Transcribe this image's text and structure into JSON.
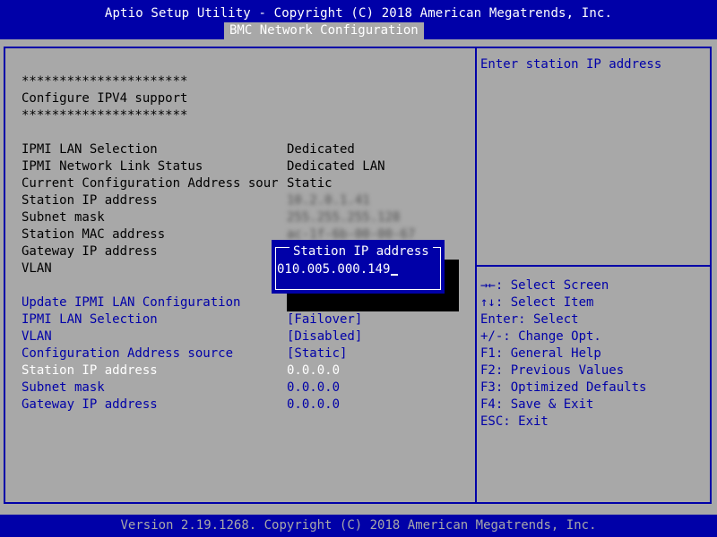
{
  "header": {
    "title": "Aptio Setup Utility - Copyright (C) 2018 American Megatrends, Inc.",
    "tab": "BMC Network Configuration"
  },
  "main": {
    "stars_top": "**********************",
    "section_title": "Configure IPV4 support",
    "stars_bottom": "**********************",
    "info_rows": [
      {
        "label": "IPMI LAN Selection",
        "value": "Dedicated"
      },
      {
        "label": "IPMI Network Link Status",
        "value": "Dedicated LAN"
      },
      {
        "label": "Current Configuration Address sour",
        "value": "Static"
      },
      {
        "label": "Station IP address",
        "value": "10.2.0.1.41"
      },
      {
        "label": "Subnet mask",
        "value": "255.255.255.128"
      },
      {
        "label": "Station MAC address",
        "value": "ac-1f-6b-00-00-67"
      },
      {
        "label": "Gateway IP address",
        "value": ""
      },
      {
        "label": "VLAN",
        "value": ""
      }
    ],
    "settings": [
      {
        "label": "Update IPMI LAN Configuration",
        "value": ""
      },
      {
        "label": "IPMI LAN Selection",
        "value": "[Failover]"
      },
      {
        "label": "VLAN",
        "value": "[Disabled]"
      },
      {
        "label": "Configuration Address source",
        "value": "[Static]"
      },
      {
        "label": "Station IP address",
        "value": "0.0.0.0"
      },
      {
        "label": "Subnet mask",
        "value": "0.0.0.0"
      },
      {
        "label": "Gateway IP address",
        "value": "0.0.0.0"
      }
    ]
  },
  "dialog": {
    "title": "Station IP address",
    "value": "010.005.000.149"
  },
  "help": {
    "description": "Enter station IP address",
    "keys": [
      "→←: Select Screen",
      "↑↓: Select Item",
      "Enter: Select",
      "+/-: Change Opt.",
      "F1: General Help",
      "F2: Previous Values",
      "F3: Optimized Defaults",
      "F4: Save & Exit",
      "ESC: Exit"
    ]
  },
  "footer": {
    "text": "Version 2.19.1268. Copyright (C) 2018 American Megatrends, Inc."
  },
  "colors": {
    "background": "#a8a8a8",
    "accent": "#0000a8",
    "highlight": "#ffffff"
  }
}
